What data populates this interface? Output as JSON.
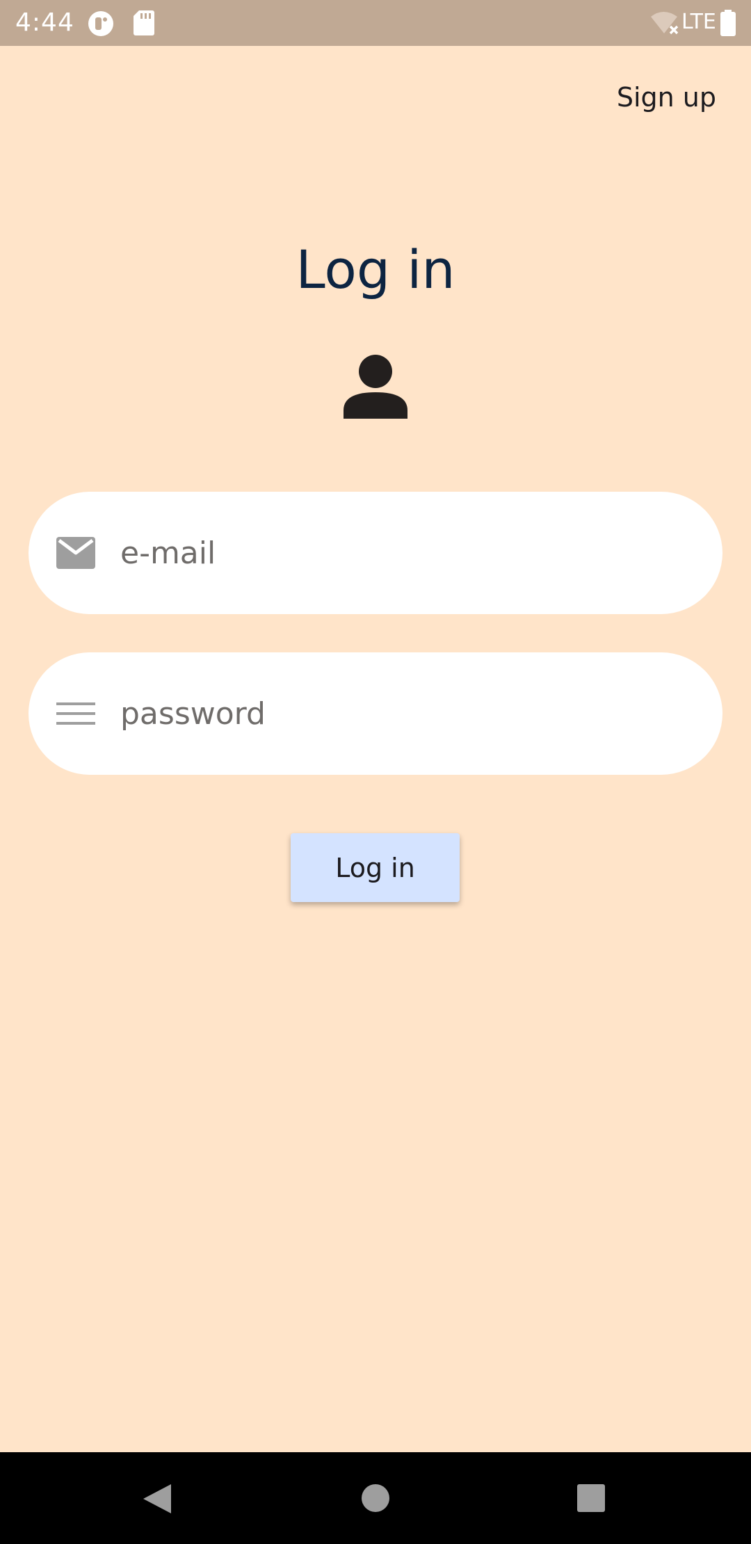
{
  "status_bar": {
    "time": "4:44",
    "network": "LTE",
    "icons": [
      "app-notification-icon",
      "sd-card-icon",
      "wifi-off-icon",
      "battery-icon"
    ]
  },
  "header": {
    "signup_label": "Sign up"
  },
  "main": {
    "title": "Log in",
    "avatar_icon": "person-icon",
    "email": {
      "placeholder": "e-mail",
      "value": "",
      "icon": "mail-icon"
    },
    "password": {
      "placeholder": "password",
      "value": "",
      "icon": "menu-lines-icon"
    },
    "login_label": "Log in"
  },
  "nav_bar": {
    "buttons": [
      "back-icon",
      "home-icon",
      "recents-icon"
    ]
  },
  "colors": {
    "background": "#ffe4c9",
    "status_bar": "#c0a994",
    "title": "#0d2441",
    "button": "#d4e3ff",
    "field": "#ffffff",
    "placeholder": "#6f6c6a"
  }
}
